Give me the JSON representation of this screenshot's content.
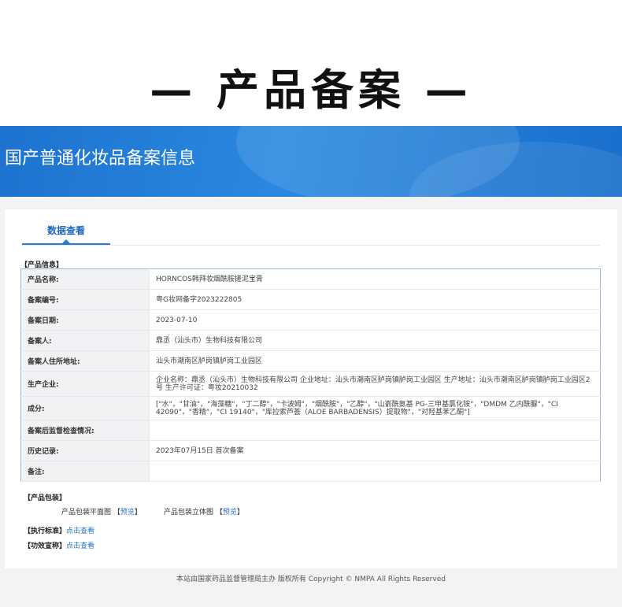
{
  "hero": {
    "title": "— 产品备案 —"
  },
  "banner": {
    "title": "国产普通化妆品备案信息"
  },
  "tab": {
    "label": "数据查看"
  },
  "product_info": {
    "section_label": "【产品信息】",
    "rows": [
      {
        "key": "产品名称:",
        "value": "HORNCOS韩拜妆烟酰胺搓泥宝膏"
      },
      {
        "key": "备案编号:",
        "value": "粤G妆网备字2023222805"
      },
      {
        "key": "备案日期:",
        "value": "2023-07-10"
      },
      {
        "key": "备案人:",
        "value": "鼎丞（汕头市）生物科技有限公司"
      },
      {
        "key": "备案人住所地址:",
        "value": "汕头市潮南区胪岗镇胪岗工业园区"
      },
      {
        "key": "生产企业:",
        "value": "企业名称：鼎丞（汕头市）生物科技有限公司 企业地址：汕头市潮南区胪岗镇胪岗工业园区 生产地址：汕头市潮南区胪岗镇胪岗工业园区2号 生产许可证：粤妆20210032"
      },
      {
        "key": "成分:",
        "value": "[\"水\"，\"甘油\"，\"海藻糖\"，\"丁二醇\"，\"卡波姆\"，\"烟酰胺\"，\"乙醇\"，\"山嵛酰氨基 PG-三甲基氯化铵\"，\"DMDM 乙内酰脲\"，\"CI 42090\"，\"香精\"，\"CI 19140\"，\"库拉索芦荟（ALOE BARBADENSIS）提取物\"，\"对羟基苯乙酮\"]"
      },
      {
        "key": "备案后监督检查情况:",
        "value": ""
      },
      {
        "key": "历史记录:",
        "value": "2023年07月15日 首次备案"
      },
      {
        "key": "备注:",
        "value": ""
      }
    ]
  },
  "packaging": {
    "section_label": "【产品包装】",
    "flat_label": "产品包装平面图",
    "solid_label": "产品包装立体图",
    "bracket_open": "【",
    "bracket_close": "】",
    "preview_label": "预览"
  },
  "standard": {
    "section_label": "【执行标准】",
    "link_label": "点击查看"
  },
  "efficacy": {
    "section_label": "【功效宣称】",
    "link_label": "点击查看"
  },
  "footer": {
    "text": "本站由国家药品监督管理局主办 版权所有 Copyright © NMPA All Rights Reserved"
  },
  "colors": {
    "banner": "#1d73cf",
    "link": "#2a72c8",
    "tab_accent": "#2a7bd6",
    "table_border": "#9ab6e0"
  }
}
